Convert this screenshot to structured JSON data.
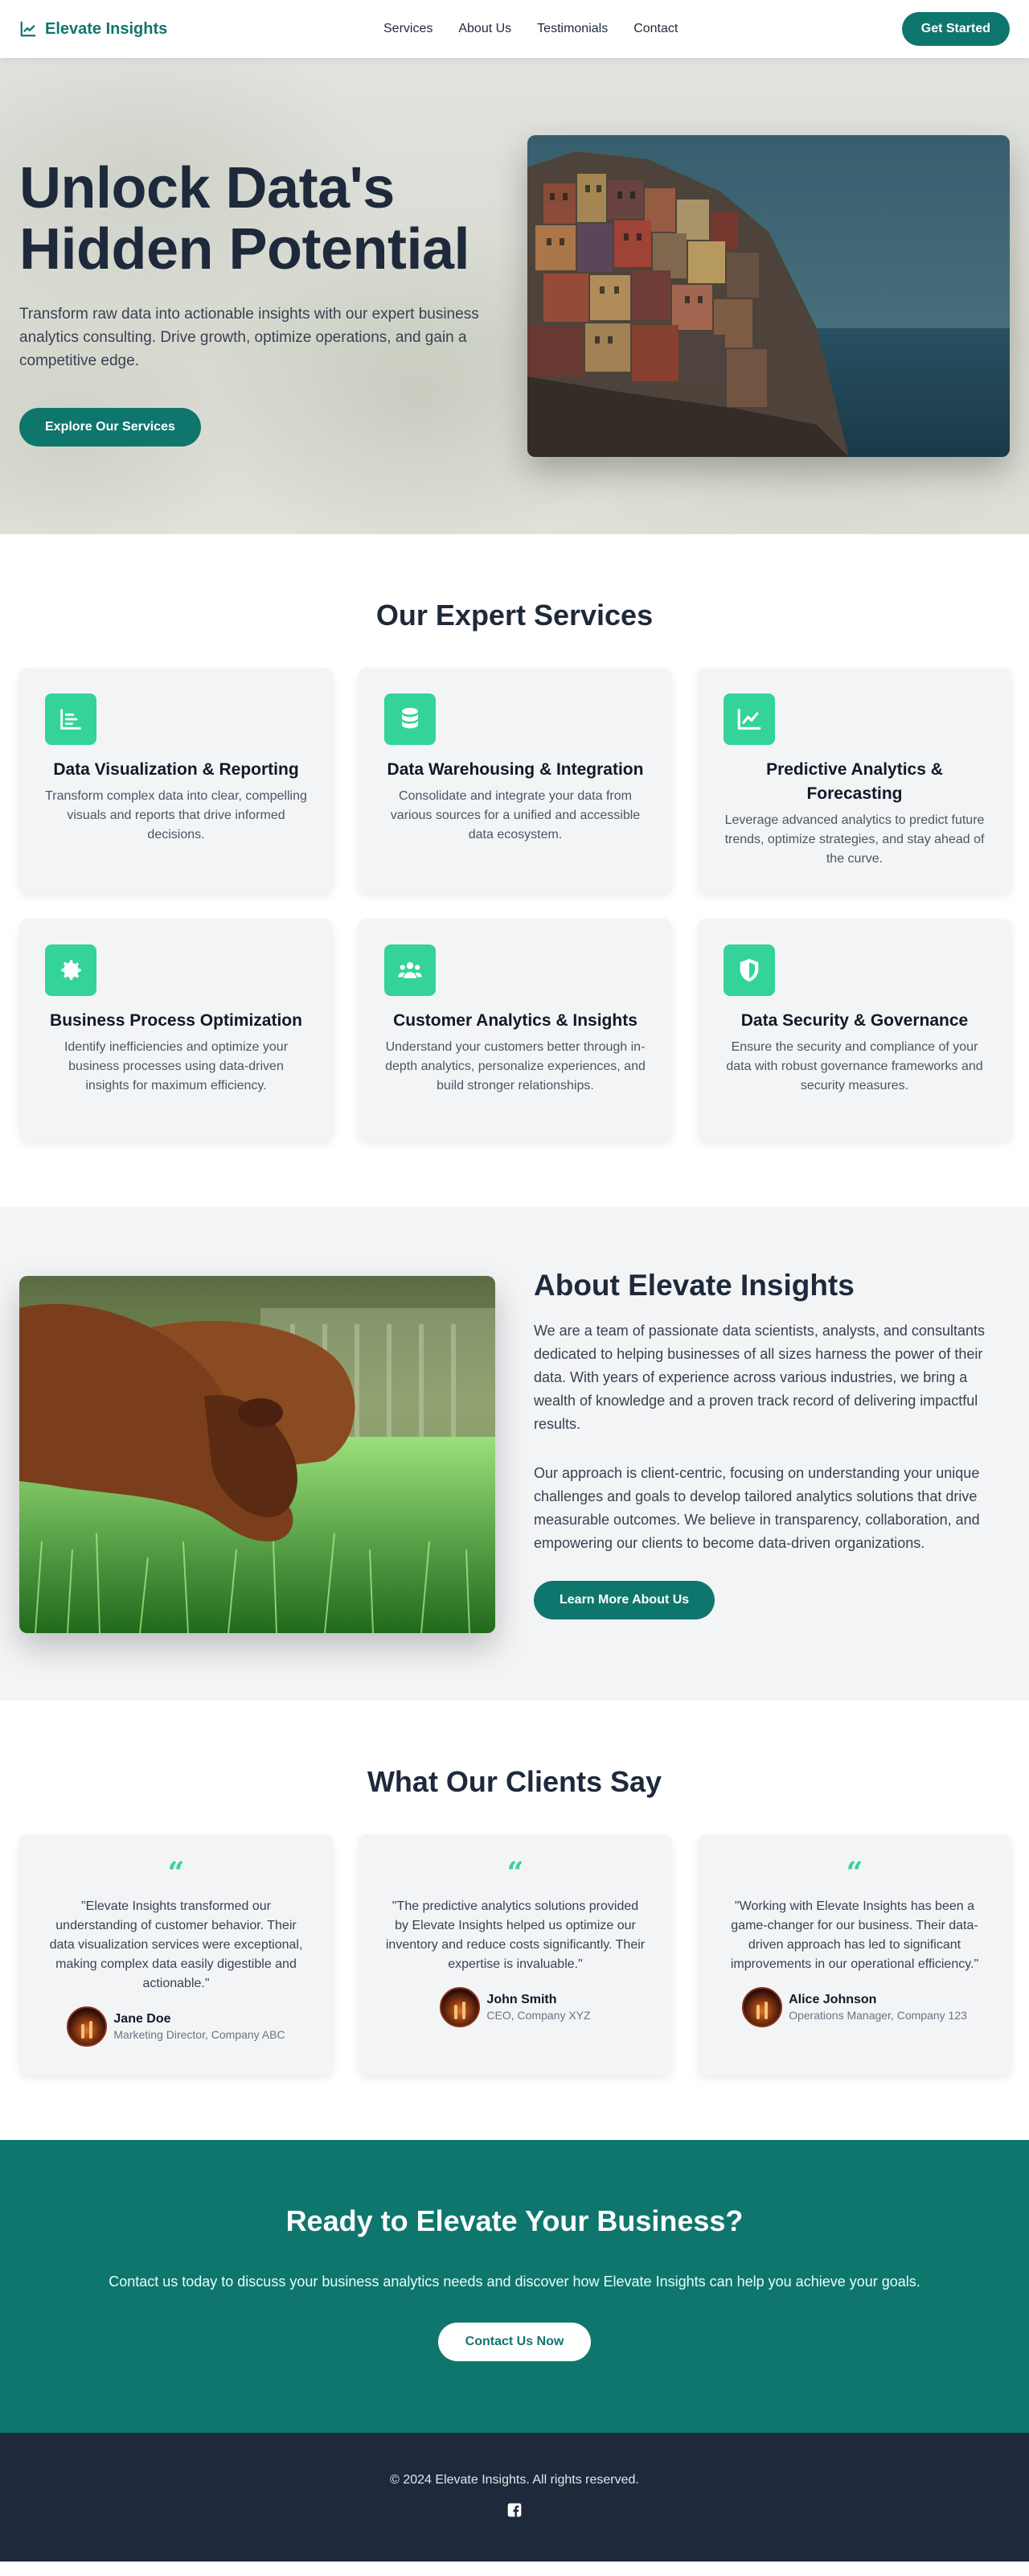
{
  "header": {
    "brand": "Elevate Insights",
    "nav": [
      "Services",
      "About Us",
      "Testimonials",
      "Contact"
    ],
    "cta": "Get Started"
  },
  "hero": {
    "title_line1": "Unlock Data's",
    "title_line2": "Hidden Potential",
    "subtitle": "Transform raw data into actionable insights with our expert business analytics consulting. Drive growth, optimize operations, and gain a competitive edge.",
    "button": "Explore Our Services"
  },
  "services": {
    "title": "Our Expert Services",
    "items": [
      {
        "icon": "report-icon",
        "title": "Data Visualization & Reporting",
        "desc": "Transform complex data into clear, compelling visuals and reports that drive informed decisions."
      },
      {
        "icon": "database-icon",
        "title": "Data Warehousing & Integration",
        "desc": "Consolidate and integrate your data from various sources for a unified and accessible data ecosystem."
      },
      {
        "icon": "line-chart-icon",
        "title": "Predictive Analytics & Forecasting",
        "desc": "Leverage advanced analytics to predict future trends, optimize strategies, and stay ahead of the curve."
      },
      {
        "icon": "gear-icon",
        "title": "Business Process Optimization",
        "desc": "Identify inefficiencies and optimize your business processes using data-driven insights for maximum efficiency."
      },
      {
        "icon": "users-icon",
        "title": "Customer Analytics & Insights",
        "desc": "Understand your customers better through in-depth analytics, personalize experiences, and build stronger relationships."
      },
      {
        "icon": "shield-icon",
        "title": "Data Security & Governance",
        "desc": "Ensure the security and compliance of your data with robust governance frameworks and security measures."
      }
    ]
  },
  "about": {
    "title": "About Elevate Insights",
    "p1": "We are a team of passionate data scientists, analysts, and consultants dedicated to helping businesses of all sizes harness the power of their data. With years of experience across various industries, we bring a wealth of knowledge and a proven track record of delivering impactful results.",
    "p2": "Our approach is client-centric, focusing on understanding your unique challenges and goals to develop tailored analytics solutions that drive measurable outcomes. We believe in transparency, collaboration, and empowering our clients to become data-driven organizations.",
    "button": "Learn More About Us"
  },
  "testimonials": {
    "title": "What Our Clients Say",
    "items": [
      {
        "quote": "\"Elevate Insights transformed our understanding of customer behavior. Their data visualization services were exceptional, making complex data easily digestible and actionable.\"",
        "name": "Jane Doe",
        "role": "Marketing Director, Company ABC"
      },
      {
        "quote": "\"The predictive analytics solutions provided by Elevate Insights helped us optimize our inventory and reduce costs significantly. Their expertise is invaluable.\"",
        "name": "John Smith",
        "role": "CEO, Company XYZ"
      },
      {
        "quote": "\"Working with Elevate Insights has been a game-changer for our business. Their data-driven approach has led to significant improvements in our operational efficiency.\"",
        "name": "Alice Johnson",
        "role": "Operations Manager, Company 123"
      }
    ]
  },
  "cta": {
    "title": "Ready to Elevate Your Business?",
    "subtitle": "Contact us today to discuss your business analytics needs and discover how Elevate Insights can help you achieve your goals.",
    "button": "Contact Us Now"
  },
  "footer": {
    "copyright": "© 2024 Elevate Insights. All rights reserved.",
    "social_icon": "facebook-icon"
  },
  "colors": {
    "primary": "#0f766e",
    "accent": "#34d399",
    "dark": "#1e293b"
  }
}
